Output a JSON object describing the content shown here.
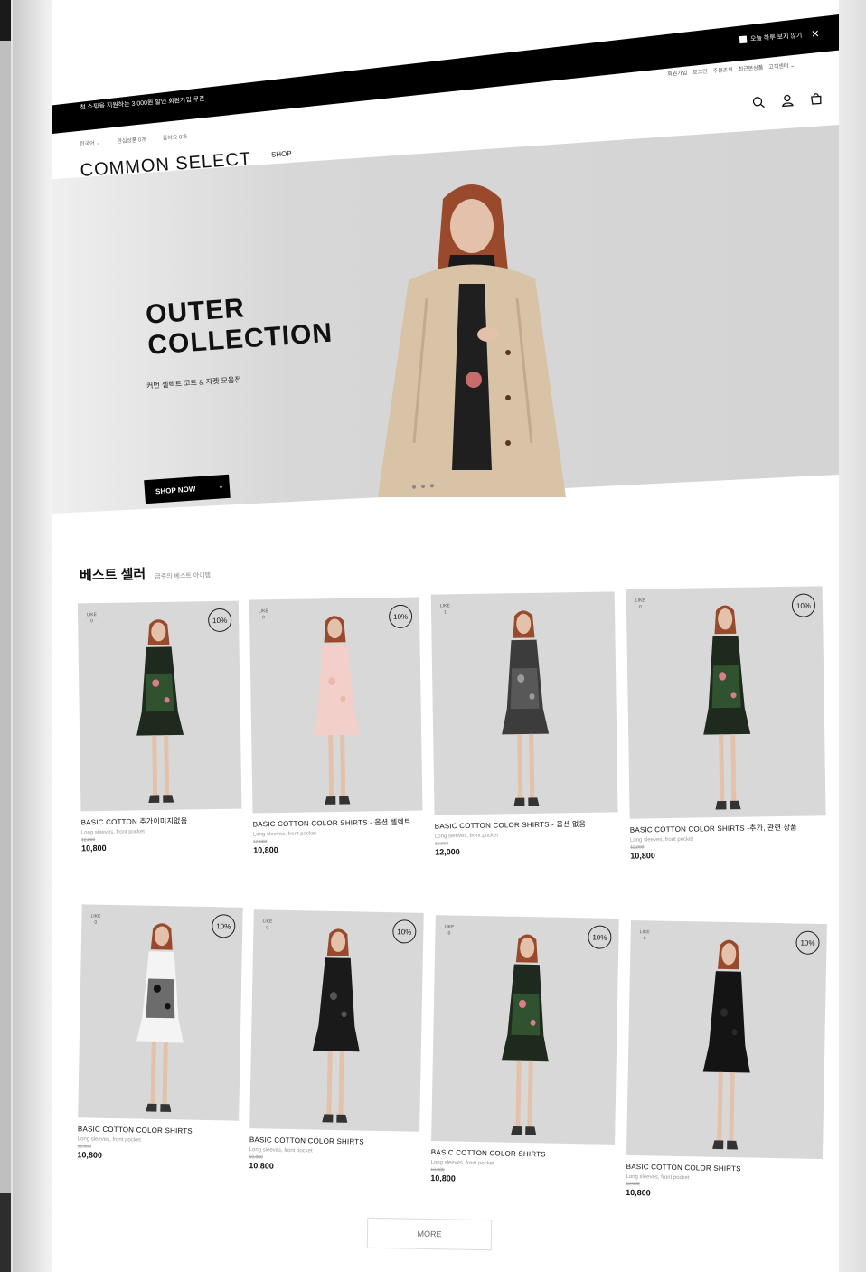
{
  "topbar": {
    "coupon_text": "첫 쇼핑을 지원하는 3,000원 할인 회원가입 쿠폰",
    "today_close_label": "오늘 하루 보지 않기",
    "close_symbol": "✕"
  },
  "header": {
    "util_links": [
      "회원가입",
      "로그인",
      "주문조회",
      "최근본상품",
      "고객센터 ⌄"
    ],
    "language": "한국어 ⌄",
    "wish_count": "관심상품 0개",
    "like_count": "좋아요 0개",
    "logo": "COMMON SELECT",
    "nav_shop": "SHOP"
  },
  "hero": {
    "title_line1": "OUTER",
    "title_line2": "COLLECTION",
    "subtitle": "커먼 셀렉트 코트 & 자켓 모음전",
    "cta_label": "SHOP NOW",
    "cta_icon": "•"
  },
  "bestseller": {
    "title": "베스트 셀러",
    "subtitle": "금주의 베스트 아이템"
  },
  "products": [
    {
      "like_label": "LIKE",
      "like_count": "0",
      "badge": "10%",
      "name": "BASIC COTTON 추가이미지없음",
      "desc": "Long sleeves, front pocket",
      "orig": "12,000",
      "price": "10,800",
      "outfit": "floral"
    },
    {
      "like_label": "LIKE",
      "like_count": "0",
      "badge": "10%",
      "name": "BASIC COTTON COLOR SHIRTS - 옵션 셀렉트",
      "desc": "Long sleeves, front pocket",
      "orig": "12,000",
      "price": "10,800",
      "outfit": "pink"
    },
    {
      "like_label": "LIKE",
      "like_count": "1",
      "badge": "",
      "name": "BASIC COTTON COLOR SHIRTS - 옵션 없음",
      "desc": "Long sleeves, front pocket",
      "orig": "12,000",
      "price": "12,000",
      "outfit": "gray"
    },
    {
      "like_label": "LIKE",
      "like_count": "0",
      "badge": "10%",
      "name": "BASIC COTTON COLOR SHIRTS -추가, 관련 상품",
      "desc": "Long sleeves, front pocket",
      "orig": "12,000",
      "price": "10,800",
      "outfit": "floral"
    },
    {
      "like_label": "LIKE",
      "like_count": "0",
      "badge": "10%",
      "name": "BASIC COTTON COLOR SHIRTS",
      "desc": "Long sleeves, front pocket",
      "orig": "12,000",
      "price": "10,800",
      "outfit": "tee"
    },
    {
      "like_label": "LIKE",
      "like_count": "0",
      "badge": "10%",
      "name": "BASIC COTTON COLOR SHIRTS",
      "desc": "Long sleeves, front pocket",
      "orig": "12,000",
      "price": "10,800",
      "outfit": "dots"
    },
    {
      "like_label": "LIKE",
      "like_count": "0",
      "badge": "10%",
      "name": "BASIC COTTON COLOR SHIRTS",
      "desc": "Long sleeves, front pocket",
      "orig": "12,000",
      "price": "10,800",
      "outfit": "floral"
    },
    {
      "like_label": "LIKE",
      "like_count": "0",
      "badge": "10%",
      "name": "BASIC COTTON COLOR SHIRTS",
      "desc": "Long sleeves, front pocket",
      "orig": "12,000",
      "price": "10,800",
      "outfit": "black"
    }
  ],
  "more_label": "MORE",
  "colors": {
    "accent": "#000000",
    "background": "#ffffff",
    "image_bg": "#d8d8d8"
  }
}
